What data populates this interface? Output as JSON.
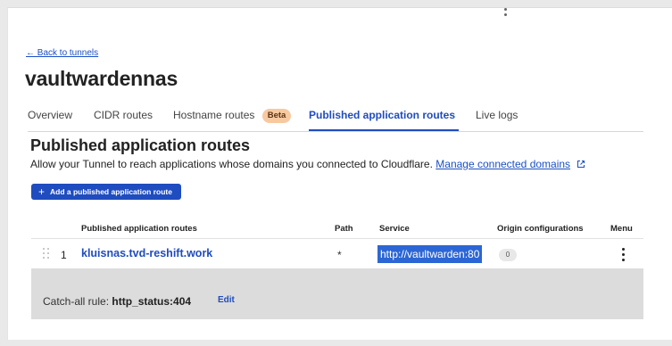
{
  "header": {
    "back_link": "← Back to tunnels",
    "title": "vaultwardennas"
  },
  "tabs": [
    {
      "label": "Overview"
    },
    {
      "label": "CIDR routes"
    },
    {
      "label": "Hostname routes",
      "badge": "Beta"
    },
    {
      "label": "Published application routes",
      "active": true
    },
    {
      "label": "Live logs"
    }
  ],
  "section": {
    "title": "Published application routes",
    "description": "Allow your Tunnel to reach applications whose domains you connected to Cloudflare.",
    "manage_link": "Manage connected domains",
    "add_button": "Add a published application route"
  },
  "table": {
    "headers": {
      "name": "Published application routes",
      "path": "Path",
      "service": "Service",
      "origin": "Origin configurations",
      "menu": "Menu"
    },
    "rows": [
      {
        "index": "1",
        "hostname": "kluisnas.tvd-reshift.work",
        "path": "*",
        "service": "http://vaultwarden:80",
        "origin_count": "0"
      }
    ]
  },
  "catch_all": {
    "label": "Catch-all rule:",
    "value": "http_status:404",
    "edit": "Edit"
  },
  "colors": {
    "accent": "#1f4cbf",
    "link": "#1a4fc4",
    "beta_badge": "#f8c9a0",
    "selection": "#2c66d4"
  }
}
